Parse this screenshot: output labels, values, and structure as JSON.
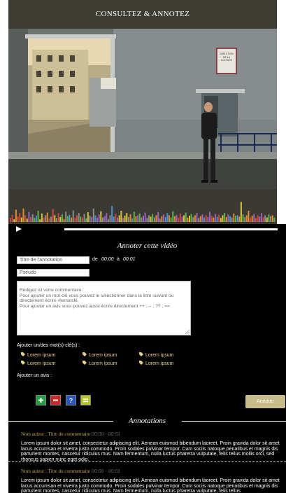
{
  "header": {
    "title": "CONSULTEZ & ANNOTEZ"
  },
  "video": {
    "sign_text": [
      "DIRECTION",
      "DE LA",
      "CULTURE"
    ]
  },
  "timeline": {
    "bar_heights": [
      0.18,
      0.32,
      0.12,
      0.55,
      0.25,
      0.4,
      0.2,
      0.6,
      0.3,
      0.15,
      0.45,
      0.22,
      0.35,
      0.18,
      0.28,
      0.5,
      0.12,
      0.38,
      0.2,
      0.3,
      0.42,
      0.16,
      0.24,
      0.58,
      0.3,
      0.18,
      0.4,
      0.22,
      0.34,
      0.14,
      0.46,
      0.26,
      0.32,
      0.2,
      0.52,
      0.18,
      0.3,
      0.4,
      0.24,
      0.2,
      0.36,
      0.16,
      0.44,
      0.28,
      0.22,
      0.6,
      0.3,
      0.18,
      0.34,
      0.48,
      0.2,
      0.26,
      0.4,
      0.14,
      0.3,
      0.72,
      0.24,
      0.36,
      0.2,
      0.3,
      0.5,
      0.18,
      0.28,
      0.4,
      0.22,
      0.34,
      0.16,
      0.46,
      0.26,
      0.3,
      0.38,
      0.2,
      0.28,
      0.42,
      0.18,
      0.3,
      0.24,
      0.36,
      0.2,
      0.3,
      0.44,
      0.16,
      0.26,
      0.34,
      0.22,
      0.4,
      0.3,
      0.2,
      0.48,
      0.26,
      0.32,
      0.18,
      0.38,
      0.24,
      0.3,
      0.42,
      0.2,
      0.28,
      0.36,
      0.22,
      0.3,
      0.4,
      0.18,
      0.26,
      0.34,
      0.2,
      0.3,
      0.22,
      0.46,
      0.28,
      0.2,
      0.36,
      0.24,
      0.32,
      0.18,
      0.3,
      0.4,
      0.22,
      0.34,
      0.26,
      0.2,
      0.38,
      0.28,
      0.3,
      0.24,
      0.9,
      0.34,
      0.22,
      0.3,
      0.5,
      0.2,
      0.28,
      0.36,
      0.18,
      0.3,
      0.24,
      0.4,
      0.22,
      0.3,
      0.2,
      0.34,
      0.26,
      0.3,
      0.2
    ],
    "colors": [
      "#8a8a8a",
      "#c94a3a",
      "#4c8fc9",
      "#5ab04a",
      "#d6c23a",
      "#9a62b8",
      "#e08a2a"
    ]
  },
  "form": {
    "section_title": "Annoter cette vidéo",
    "title_placeholder": "Titre de l'annotation",
    "de_label": "de",
    "start_time": "00:00",
    "a_label": "à",
    "end_time": "00:01",
    "pseudo_placeholder": "Pseudo",
    "comment_placeholder": "Rédigez ici votre commentaire.\nPour ajouter un mot-clé vous pouvez le sélectionner dans la liste suivant ou directement écrire #lemotclé.\nPour ajouter un avis vous pouvez aussi écrire directement ++ ; -- ; ?? ; ==",
    "keywords_label": "Ajouter un/des mot(s)-clé(s) :",
    "keywords": [
      "Lorem ipsum",
      "Lorem ipsum",
      "Lorem ipsum",
      "Lorem ipsum",
      "Lorem ipsum",
      "Lorem ipsum"
    ],
    "opinion_label": "Ajouter un avis :",
    "opinions": [
      {
        "name": "plus",
        "bg": "#1f9e3e",
        "glyph": "+"
      },
      {
        "name": "minus",
        "bg": "#cc2a2a",
        "glyph": "−"
      },
      {
        "name": "question",
        "bg": "#2a55b8",
        "glyph": "?"
      },
      {
        "name": "equal",
        "bg": "#b8c42a",
        "glyph": "="
      }
    ],
    "submit_label": "Annoter"
  },
  "annotations": {
    "section_title": "Annotations",
    "items": [
      {
        "head": "Nom auteur : Titre du commentaire",
        "time": "00:00 - 00:01",
        "body": "Lorem ipsum dolor sit amet, consectetur adipiscing elit. Aenean euismod bibendum laoreet. Proin gravida dolor sit amet lacus accumsan et viverra justo commodo. Proin sodales pulvinar tempor. Cum sociis natoque penatibus et magnis dis parturient montes, nascetur ridiculus mus. Nam fermentum, nulla luctus pharetra vulputate, felis tellus mollis orci, sed rhoncus sapien nunc eget odio."
      },
      {
        "head": "Nom auteur : Titre du commentaire",
        "time": "00:00 - 00:01",
        "body": "Lorem ipsum dolor sit amet, consectetur adipiscing elit. Aenean euismod bibendum laoreet. Proin gravida dolor sit amet lacus accumsan et viverra justo commodo. Proin sodales pulvinar tempor. Cum sociis natoque penatibus et magnis dis parturient montes, nascetur ridiculus mus. Nam fermentum, nulla luctus pharetra vulputate, felis tellus"
      }
    ]
  },
  "colors": {
    "accent": "#c7bc8a",
    "header_bg": "#3c3c33",
    "author_color": "#c9a44e",
    "keyword_color": "#e7cf8a"
  }
}
